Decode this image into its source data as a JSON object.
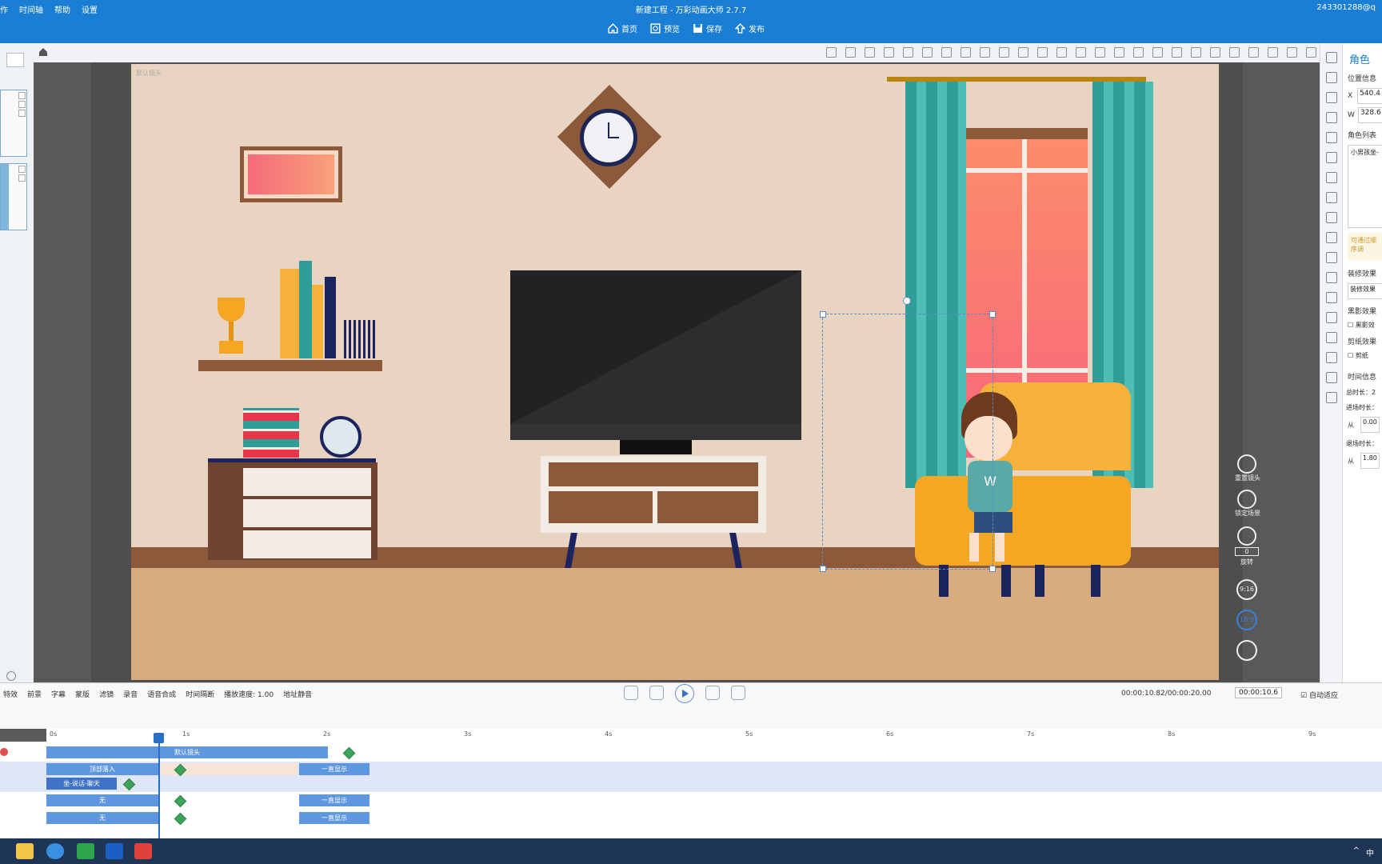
{
  "menu": [
    "作",
    "时间轴",
    "帮助",
    "设置"
  ],
  "app_title": "新建工程 - 万彩动画大师 2.7.7",
  "account": "2433012​88@q",
  "nav": [
    {
      "label": "首页",
      "icon": "home-icon"
    },
    {
      "label": "预览",
      "icon": "preview-icon"
    },
    {
      "label": "保存",
      "icon": "save-icon"
    },
    {
      "label": "发布",
      "icon": "publish-icon"
    }
  ],
  "stage": {
    "camera_label": "默认镜头",
    "side_controls": [
      "重置镜头",
      "锁定场景",
      "旋转",
      "9:16",
      "16:9"
    ],
    "rotate_value": "0"
  },
  "props": {
    "header": "角色",
    "position_label": "位置信息",
    "x_label": "X",
    "x_value": "540.4",
    "w_label": "W",
    "w_value": "328.6",
    "role_list_label": "角色列表",
    "role_item": "小男孩坐-",
    "hint": "可通过顺序调",
    "decor_label": "装修效果",
    "decor_value": "装修效果",
    "shadow_label": "黑影效果",
    "shadow_value": "黑影效",
    "cutpaper_label": "剪纸效果",
    "cutpaper_value": "剪纸",
    "time_label": "时间信息",
    "total_label": "总时长：",
    "total_value": "2",
    "enter_label": "进场时长：",
    "from_label": "从",
    "enter_value": "0.00",
    "exit_label": "退场时长：",
    "exit_value": "1.80"
  },
  "timeline": {
    "tools": [
      "特效",
      "前景",
      "字幕",
      "蒙版",
      "滤镜",
      "录音",
      "语音合成",
      "时间隔断",
      "播放速度: 1.00",
      "地址静音"
    ],
    "timecode": "00:00:10.82/00:00:20.00",
    "zoom": "00:00:10.6",
    "autofit": "自动适应",
    "ruler": [
      "0s",
      "1s",
      "2s",
      "3s",
      "4s",
      "5s",
      "6s",
      "7s",
      "8s",
      "9s"
    ],
    "camera_track": "默认镜头",
    "enter_effect": "顶部落入",
    "exit_effect": "一直显示",
    "action_label": "坐-说话-聊天",
    "none_label": "无"
  },
  "taskbar": {
    "ime": "中",
    "apps": [
      "file-explorer-icon",
      "browser-icon",
      "green-app-icon",
      "animation-maker-icon",
      "red-app-icon"
    ]
  },
  "colors": {
    "accent": "#1a7fd4",
    "wall": "#e8d4c1",
    "floor": "#d9ab80",
    "sofa": "#f5a623",
    "curtain": "#39a9a7",
    "tv": "#222222",
    "track_block": "#5e97e0",
    "keyframe": "#3da35a"
  }
}
